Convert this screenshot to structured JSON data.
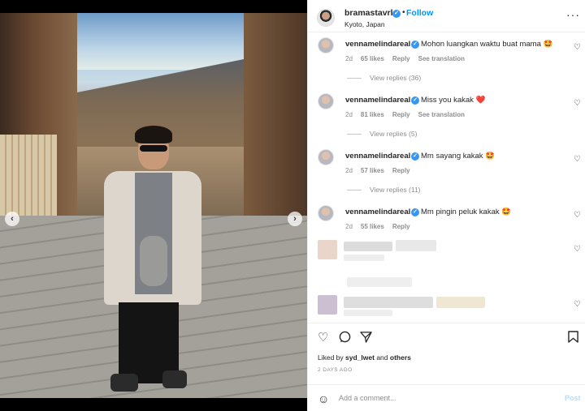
{
  "post": {
    "username": "bramastavrl",
    "follow_label": "Follow",
    "separator": "•",
    "location": "Kyoto, Japan",
    "more_icon": "more-icon"
  },
  "photo": {
    "prev_icon": "‹",
    "next_icon": "›"
  },
  "comments": [
    {
      "user": "vennamelindareal",
      "text": "Mohon luangkan waktu buat mama 🤩",
      "time": "2d",
      "likes": "65 likes",
      "reply": "Reply",
      "translate": "See translation",
      "replies": "View replies (36)"
    },
    {
      "user": "vennamelindareal",
      "text": "Miss you kakak ❤️",
      "time": "2d",
      "likes": "81 likes",
      "reply": "Reply",
      "translate": "See translation",
      "replies": "View replies (5)"
    },
    {
      "user": "vennamelindareal",
      "text": "Mm sayang kakak 🤩",
      "time": "2d",
      "likes": "57 likes",
      "reply": "Reply",
      "translate": "",
      "replies": "View replies (11)"
    },
    {
      "user": "vennamelindareal",
      "text": "Mm pingin peluk kakak 🤩",
      "time": "2d",
      "likes": "55 likes",
      "reply": "Reply",
      "translate": "",
      "replies": ""
    }
  ],
  "actions": {
    "heart_icon": "♡",
    "comment_icon": "💬",
    "share_icon": "➤",
    "save_icon": "🔖"
  },
  "liked_by": {
    "prefix": "Liked by",
    "user": "syd_lwet",
    "and": "and",
    "others": "others"
  },
  "posted_ago": "2 DAYS AGO",
  "composer": {
    "emoji_icon": "☺",
    "placeholder": "Add a comment...",
    "post_label": "Post"
  },
  "colors": {
    "accent": "#0095f6",
    "verified": "#3797f0",
    "muted": "#8e8e8e"
  }
}
